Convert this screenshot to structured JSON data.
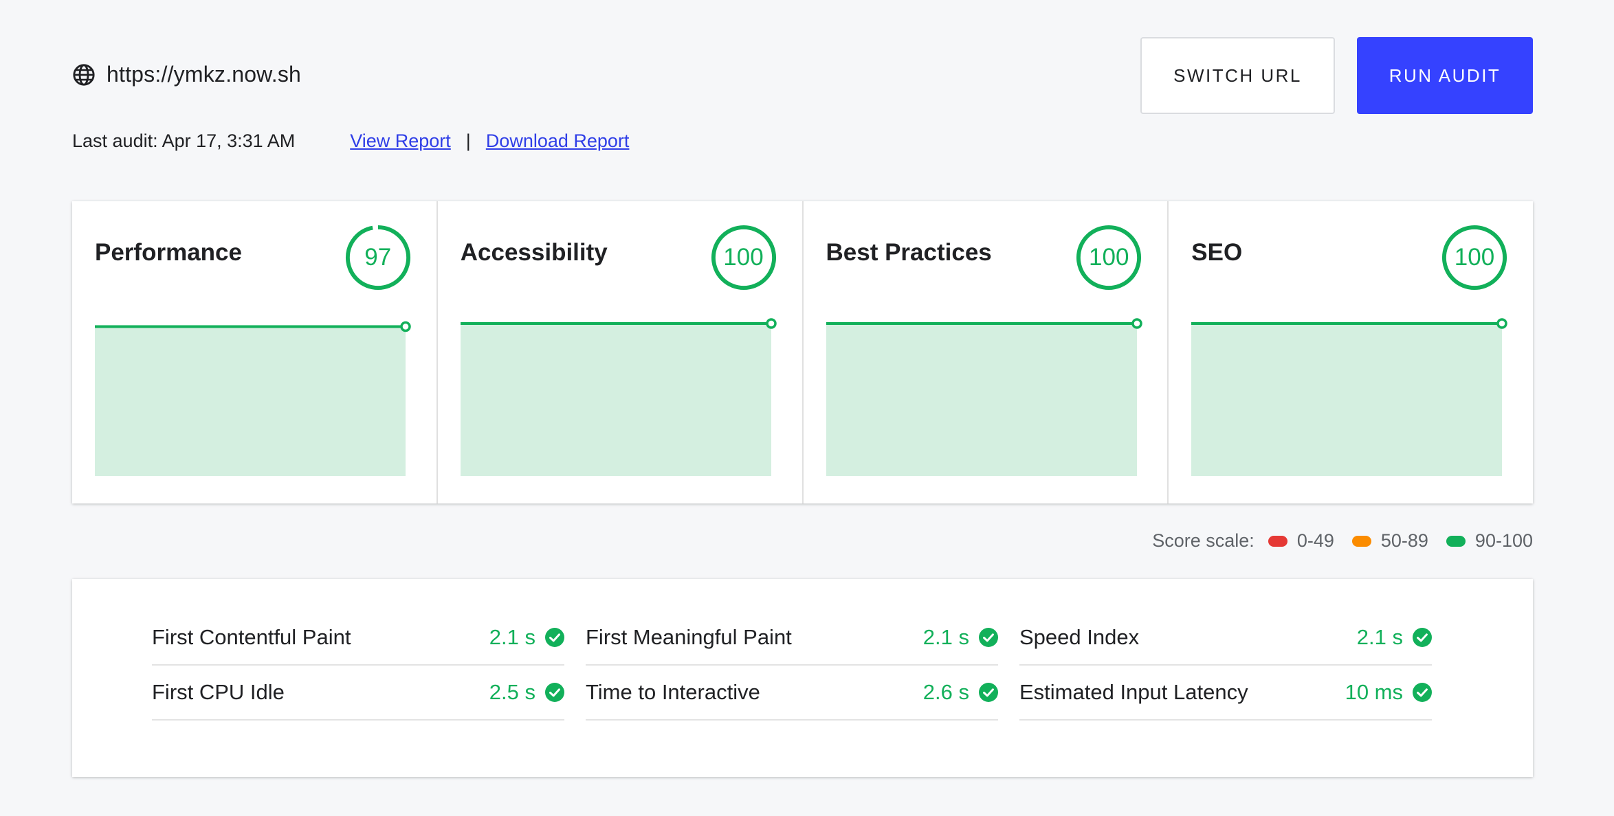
{
  "header": {
    "url": "https://ymkz.now.sh",
    "url_icon": "globe-icon",
    "last_audit": "Last audit: Apr 17, 3:31 AM",
    "view_report": "View Report ",
    "separator": "|",
    "download_report": "Download Report",
    "switch_url_label": "SWITCH URL",
    "run_audit_label": "RUN AUDIT"
  },
  "colors": {
    "accent": "#3542ff",
    "good": "#12b05a",
    "good_fill": "#d4efe0",
    "average": "#fb8c00",
    "poor": "#e53935"
  },
  "cards": [
    {
      "title": "Performance",
      "score": "97",
      "score_value": 97,
      "history": [
        97
      ]
    },
    {
      "title": "Accessibility",
      "score": "100",
      "score_value": 100,
      "history": [
        100
      ]
    },
    {
      "title": "Best Practices",
      "score": "100",
      "score_value": 100,
      "history": [
        100
      ]
    },
    {
      "title": "SEO",
      "score": "100",
      "score_value": 100,
      "history": [
        100
      ]
    }
  ],
  "score_scale": {
    "label": "Score scale:",
    "ranges": [
      {
        "label": "0-49",
        "color": "#e53935"
      },
      {
        "label": "50-89",
        "color": "#fb8c00"
      },
      {
        "label": "90-100",
        "color": "#12b05a"
      }
    ]
  },
  "metrics": [
    {
      "name": "First Contentful Paint",
      "value": "2.1 s"
    },
    {
      "name": "First Meaningful Paint",
      "value": "2.1 s"
    },
    {
      "name": "Speed Index",
      "value": "2.1 s"
    },
    {
      "name": "First CPU Idle",
      "value": "2.5 s"
    },
    {
      "name": "Time to Interactive",
      "value": "2.6 s"
    },
    {
      "name": "Estimated Input Latency",
      "value": "10 ms"
    }
  ]
}
